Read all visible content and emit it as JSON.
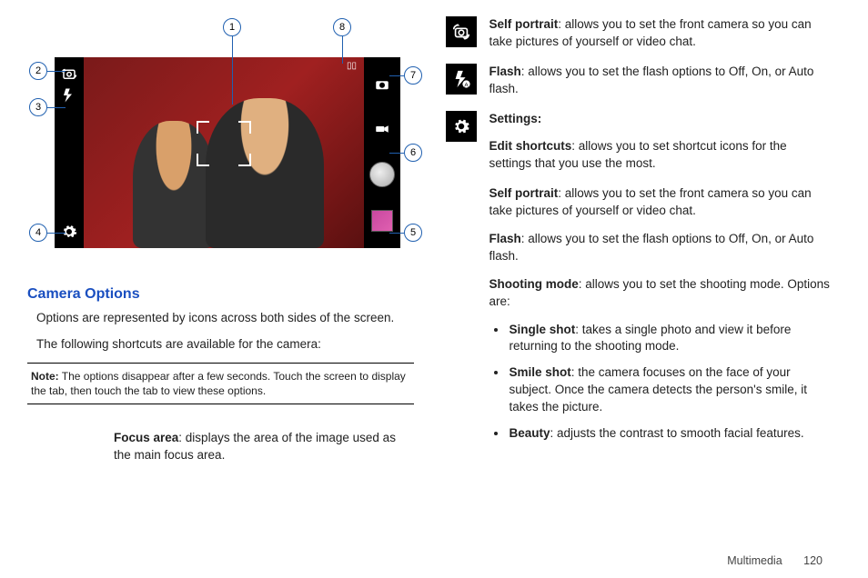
{
  "callouts": {
    "n1": "1",
    "n2": "2",
    "n3": "3",
    "n4": "4",
    "n5": "5",
    "n6": "6",
    "n7": "7",
    "n8": "8"
  },
  "section_heading": "Camera Options",
  "intro1": "Options are represented by icons across both sides of the screen.",
  "intro2": "The following shortcuts are available for the camera:",
  "note_label": "Note:",
  "note_text": " The options disappear after a few seconds. Touch the screen to display the tab, then touch the tab to view these options.",
  "focus_area_label": "Focus area",
  "focus_area_text": ": displays the area of the image used as the main focus area.",
  "self_portrait_label": "Self portrait",
  "self_portrait_text": ": allows you to set the front camera so you can take pictures of yourself or video chat.",
  "flash_label": "Flash",
  "flash_text": ": allows you to set the flash options to Off, On, or Auto flash.",
  "settings_label": "Settings:",
  "edit_shortcuts_label": "Edit shortcuts",
  "edit_shortcuts_text": ": allows you to set shortcut icons for the settings that you use the most.",
  "self_portrait2_label": "Self portrait",
  "self_portrait2_text": ": allows you to set the front camera so you can take pictures of yourself or video chat.",
  "flash2_label": "Flash",
  "flash2_text": ": allows you to set the flash options to Off, On, or Auto flash.",
  "shooting_mode_label": "Shooting mode",
  "shooting_mode_text": ": allows you to set the shooting mode. Options are:",
  "bullets": {
    "single_label": "Single shot",
    "single_text": ": takes a single photo and view it before returning to the shooting mode.",
    "smile_label": "Smile shot",
    "smile_text": ": the camera focuses on the face of your subject. Once the camera detects the person's smile, it takes the picture.",
    "beauty_label": "Beauty",
    "beauty_text": ": adjusts the contrast to smooth facial features."
  },
  "footer_section": "Multimedia",
  "footer_page": "120"
}
